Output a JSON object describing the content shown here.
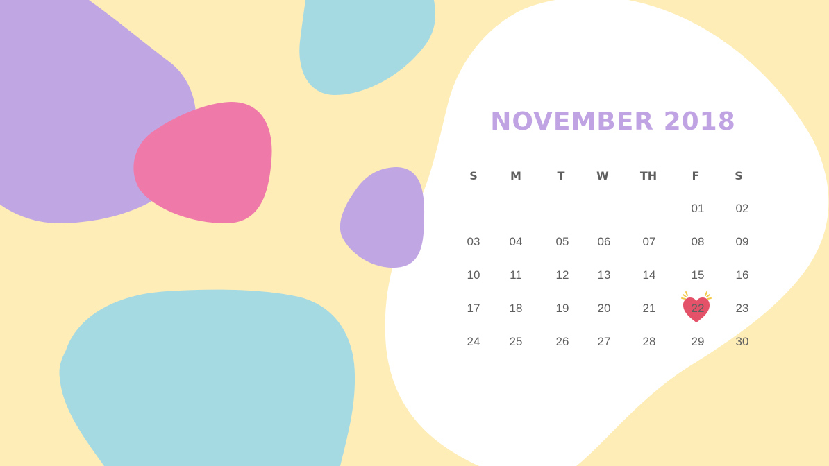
{
  "calendar": {
    "title": "NOVEMBER 2018",
    "weekdays": [
      "S",
      "M",
      "T",
      "W",
      "TH",
      "F",
      "S"
    ],
    "weeks": [
      [
        "",
        "",
        "",
        "",
        "",
        "01",
        "02"
      ],
      [
        "03",
        "04",
        "05",
        "06",
        "07",
        "08",
        "09"
      ],
      [
        "10",
        "11",
        "12",
        "13",
        "14",
        "15",
        "16"
      ],
      [
        "17",
        "18",
        "19",
        "20",
        "21",
        "22",
        "23"
      ],
      [
        "24",
        "25",
        "26",
        "27",
        "28",
        "29",
        "30"
      ]
    ],
    "highlighted_day": "22"
  },
  "colors": {
    "background": "#feedb7",
    "purple": "#c0a6e3",
    "pink": "#ef7aaa",
    "blue": "#a6dae3",
    "white": "#ffffff",
    "title": "#c0a3e2",
    "text": "#5f5f5f",
    "heart": "#e4526a",
    "heart_sparkle": "#f2c94c"
  },
  "icons": {
    "highlight_marker": "heart-icon"
  }
}
